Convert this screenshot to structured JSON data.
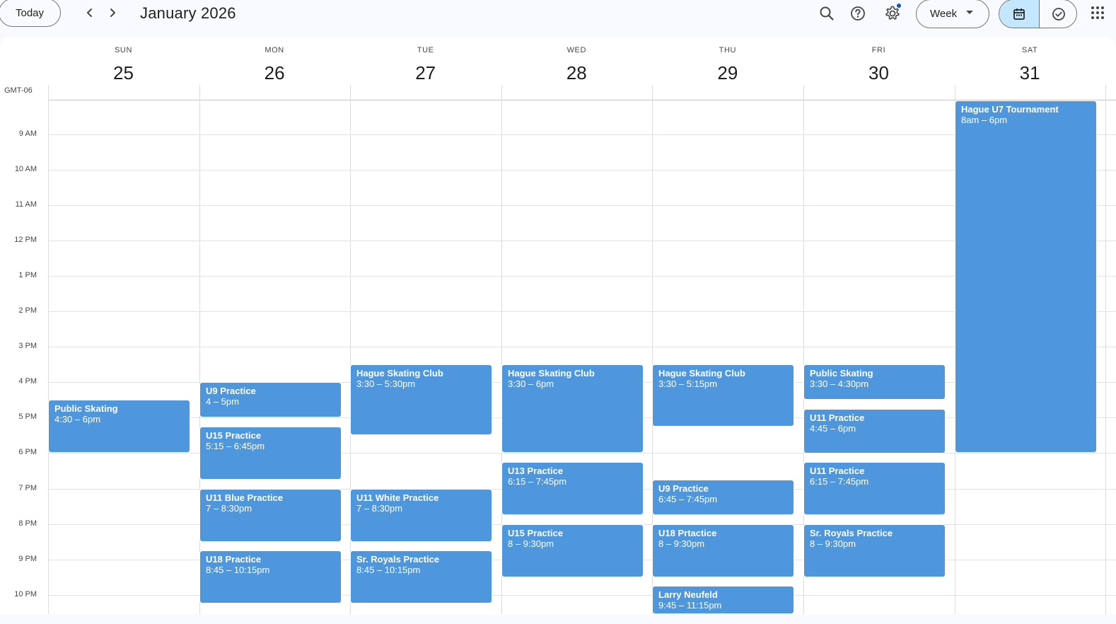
{
  "header": {
    "today_label": "Today",
    "month_title": "January 2026",
    "view_label": "Week",
    "icons": [
      "chevron-left-icon",
      "chevron-right-icon",
      "search-icon",
      "help-icon",
      "settings-icon",
      "caret-down-icon",
      "calendar-icon",
      "tasks-check-icon",
      "apps-grid-icon"
    ]
  },
  "calendar": {
    "timezone": "GMT-06",
    "days": [
      {
        "dow": "SUN",
        "num": "25"
      },
      {
        "dow": "MON",
        "num": "26"
      },
      {
        "dow": "TUE",
        "num": "27"
      },
      {
        "dow": "WED",
        "num": "28"
      },
      {
        "dow": "THU",
        "num": "29"
      },
      {
        "dow": "FRI",
        "num": "30"
      },
      {
        "dow": "SAT",
        "num": "31"
      }
    ],
    "hours": [
      {
        "label": "9 AM",
        "value": 9
      },
      {
        "label": "10 AM",
        "value": 10
      },
      {
        "label": "11 AM",
        "value": 11
      },
      {
        "label": "12 PM",
        "value": 12
      },
      {
        "label": "1 PM",
        "value": 13
      },
      {
        "label": "2 PM",
        "value": 14
      },
      {
        "label": "3 PM",
        "value": 15
      },
      {
        "label": "4 PM",
        "value": 16
      },
      {
        "label": "5 PM",
        "value": 17
      },
      {
        "label": "6 PM",
        "value": 18
      },
      {
        "label": "7 PM",
        "value": 19
      },
      {
        "label": "8 PM",
        "value": 20
      },
      {
        "label": "9 PM",
        "value": 21
      },
      {
        "label": "10 PM",
        "value": 22
      }
    ],
    "event_color": "#4f97dc",
    "events": [
      {
        "day": 0,
        "title": "Public Skating",
        "time": "4:30 – 6pm",
        "start": 16.5,
        "end": 18
      },
      {
        "day": 1,
        "title": "U9 Practice",
        "time": "4 – 5pm",
        "start": 16,
        "end": 17
      },
      {
        "day": 1,
        "title": "U15 Practice",
        "time": "5:15 – 6:45pm",
        "start": 17.25,
        "end": 18.75
      },
      {
        "day": 1,
        "title": "U11 Blue Practice",
        "time": "7 – 8:30pm",
        "start": 19,
        "end": 20.5
      },
      {
        "day": 1,
        "title": "U18 Practice",
        "time": "8:45 – 10:15pm",
        "start": 20.75,
        "end": 22.25
      },
      {
        "day": 2,
        "title": "Hague Skating Club",
        "time": "3:30 – 5:30pm",
        "start": 15.5,
        "end": 17.5
      },
      {
        "day": 2,
        "title": "U11 White Practice",
        "time": "7 – 8:30pm",
        "start": 19,
        "end": 20.5
      },
      {
        "day": 2,
        "title": "Sr. Royals Practice",
        "time": "8:45 – 10:15pm",
        "start": 20.75,
        "end": 22.25
      },
      {
        "day": 3,
        "title": "Hague Skating Club",
        "time": "3:30 – 6pm",
        "start": 15.5,
        "end": 18
      },
      {
        "day": 3,
        "title": "U13 Practice",
        "time": "6:15 – 7:45pm",
        "start": 18.25,
        "end": 19.75
      },
      {
        "day": 3,
        "title": "U15 Practice",
        "time": "8 – 9:30pm",
        "start": 20,
        "end": 21.5
      },
      {
        "day": 4,
        "title": "Hague Skating Club",
        "time": "3:30 – 5:15pm",
        "start": 15.5,
        "end": 17.25
      },
      {
        "day": 4,
        "title": "U9 Practice",
        "time": "6:45 – 7:45pm",
        "start": 18.75,
        "end": 19.75
      },
      {
        "day": 4,
        "title": "U18 Prtactice",
        "time": "8 – 9:30pm",
        "start": 20,
        "end": 21.5
      },
      {
        "day": 4,
        "title": "Larry Neufeld",
        "time": "9:45 – 11:15pm",
        "start": 21.75,
        "end": 23.25
      },
      {
        "day": 5,
        "title": "Public Skating",
        "time": "3:30 – 4:30pm",
        "start": 15.5,
        "end": 16.5
      },
      {
        "day": 5,
        "title": "U11 Practice",
        "time": "4:45 – 6pm",
        "start": 16.75,
        "end": 18
      },
      {
        "day": 5,
        "title": "U11 Practice",
        "time": "6:15 – 7:45pm",
        "start": 18.25,
        "end": 19.75
      },
      {
        "day": 5,
        "title": "Sr. Royals Practice",
        "time": "8 – 9:30pm",
        "start": 20,
        "end": 21.5
      },
      {
        "day": 6,
        "title": "Hague U7 Tournament",
        "time": "8am – 6pm",
        "start": 8,
        "end": 18
      }
    ]
  }
}
